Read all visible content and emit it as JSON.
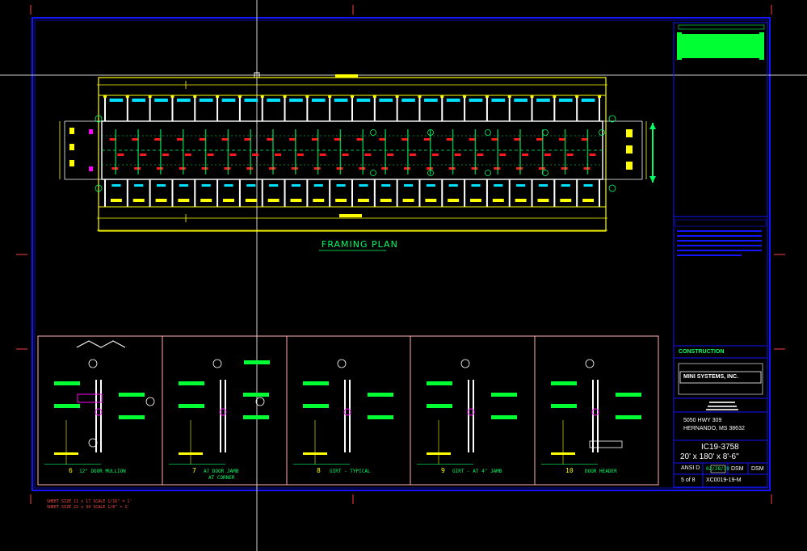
{
  "drawing": {
    "framing_plan_title": "FRAMING PLAN",
    "details": [
      {
        "num": "6",
        "caption": "12\" DOOR MULLION"
      },
      {
        "num": "7",
        "caption": "A7 DOOR JAMB"
      },
      {
        "num": "8",
        "caption": "GIRT - TYPICAL"
      },
      {
        "num": "9",
        "caption": "GIRT - AT 4\" JAMB"
      },
      {
        "num": "10",
        "caption": "DOOR HEADER"
      }
    ],
    "detail7_sub": "AT CORNER",
    "sheet_notes": [
      "SHEET SIZE 11 x 17   SCALE 1/16\" = 1'",
      "SHEET SIZE 22 x 34   SCALE 1/8\" = 1'"
    ]
  },
  "title_block": {
    "status": "CONSTRUCTION",
    "company": "MINI SYSTEMS, INC.",
    "address_line1": "5050 HWY 309",
    "address_line2": "HERNANDO, MS 38632",
    "job_number": "IC19-3758",
    "building_size": "20' x 180' x 8'-6\"",
    "paper": "ANSI D",
    "date": "02/28/19",
    "drawn_by": "DSM",
    "checked_by": "DSM",
    "sheet": "5 of 8",
    "drawing_number": "XC0019-19-M"
  },
  "colors": {
    "background": "#000000",
    "border": "#1414ff",
    "wall": "#ffffff",
    "frame": "#ffff00",
    "dimension": "#00ff66",
    "tag": "#ff1a1a",
    "accent": "#ff00ff",
    "detail_frame": "#ffb0b0"
  }
}
